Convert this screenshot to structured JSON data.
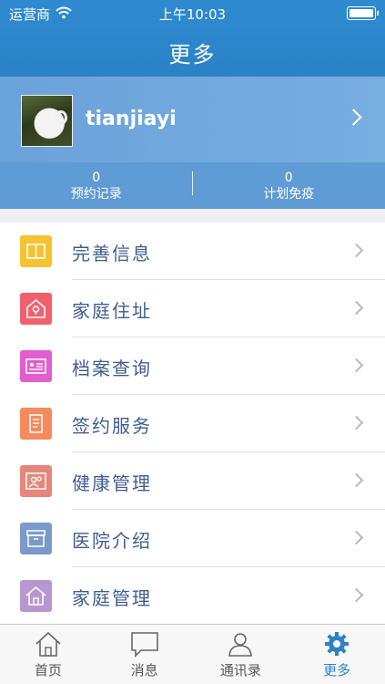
{
  "status_bar": {
    "carrier": "运营商",
    "time": "上午10:03"
  },
  "nav": {
    "title": "更多"
  },
  "profile": {
    "username": "tianjiayi",
    "stats": [
      {
        "value": "0",
        "label": "预约记录"
      },
      {
        "value": "0",
        "label": "计划免疫"
      }
    ]
  },
  "menu": {
    "items": [
      {
        "label": "完善信息",
        "icon": "book-icon",
        "color": "#f6c230"
      },
      {
        "label": "家庭住址",
        "icon": "location-house-icon",
        "color": "#f2606d"
      },
      {
        "label": "档案查询",
        "icon": "id-card-icon",
        "color": "#e15ed0"
      },
      {
        "label": "签约服务",
        "icon": "scroll-icon",
        "color": "#f58a5c"
      },
      {
        "label": "健康管理",
        "icon": "people-icon",
        "color": "#e5877c"
      },
      {
        "label": "医院介绍",
        "icon": "archive-box-icon",
        "color": "#7b9acb"
      },
      {
        "label": "家庭管理",
        "icon": "home-icon",
        "color": "#b896cf"
      }
    ]
  },
  "tabbar": {
    "tabs": [
      {
        "label": "首页",
        "icon": "home-outline-icon",
        "active": false
      },
      {
        "label": "消息",
        "icon": "chat-bubble-icon",
        "active": false
      },
      {
        "label": "通讯录",
        "icon": "contact-person-icon",
        "active": false
      },
      {
        "label": "更多",
        "icon": "gear-icon",
        "active": true
      }
    ]
  },
  "colors": {
    "nav_bg": "#2b83c6",
    "profile_bg": "#6ea5db",
    "label_text": "#3f5e8f",
    "active_tab": "#2b83c6"
  }
}
